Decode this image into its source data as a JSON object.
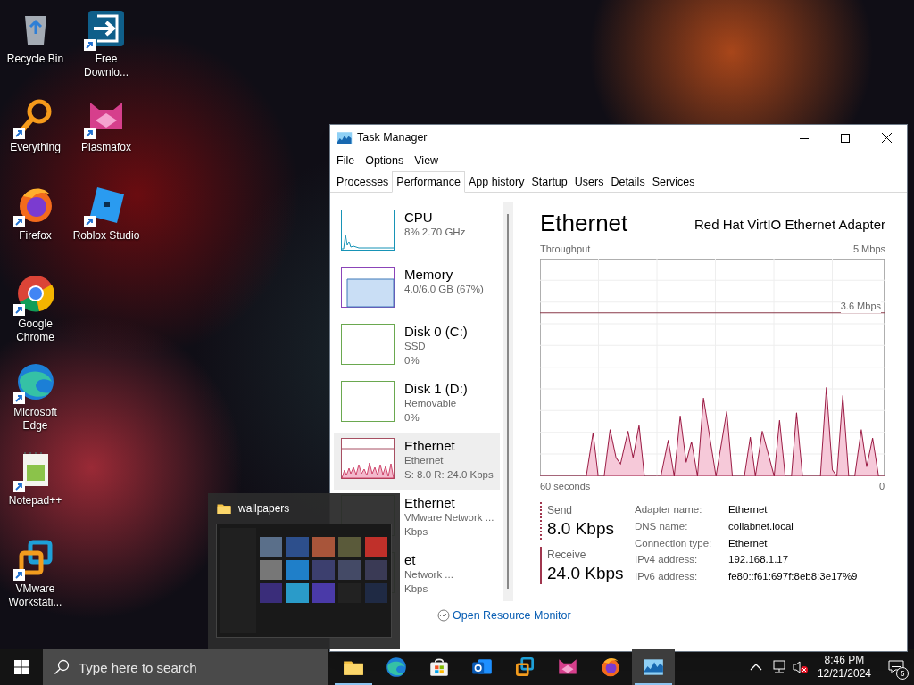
{
  "desktop_icons": [
    {
      "label": "Recycle Bin",
      "kind": "recycle",
      "shortcut": false
    },
    {
      "label": "Everything",
      "kind": "magnifier",
      "shortcut": true
    },
    {
      "label": "Firefox",
      "kind": "fox",
      "shortcut": true
    },
    {
      "label": "Google Chrome",
      "kind": "ring",
      "shortcut": true
    },
    {
      "label": "Microsoft Edge",
      "kind": "wave",
      "shortcut": true
    },
    {
      "label": "Notepad++",
      "kind": "notepad",
      "shortcut": true
    },
    {
      "label": "VMware Workstati...",
      "kind": "squares",
      "shortcut": true
    },
    {
      "label": "Free Downlo...",
      "kind": "download",
      "shortcut": true
    },
    {
      "label": "Plasmafox",
      "kind": "cat",
      "shortcut": true
    },
    {
      "label": "Roblox Studio",
      "kind": "tilted",
      "shortcut": true
    }
  ],
  "window": {
    "title": "Task Manager",
    "menu": [
      "File",
      "Options",
      "View"
    ],
    "tabs": [
      {
        "label": "Processes",
        "selected": false
      },
      {
        "label": "Performance",
        "selected": true
      },
      {
        "label": "App history",
        "selected": false
      },
      {
        "label": "Startup",
        "selected": false
      },
      {
        "label": "Users",
        "selected": false
      },
      {
        "label": "Details",
        "selected": false
      },
      {
        "label": "Services",
        "selected": false
      }
    ],
    "sidebar": [
      {
        "title": "CPU",
        "lines": [
          "8% 2.70 GHz"
        ],
        "kind": "cpu",
        "selected": false
      },
      {
        "title": "Memory",
        "lines": [
          "4.0/6.0 GB (67%)"
        ],
        "kind": "memory",
        "selected": false
      },
      {
        "title": "Disk 0 (C:)",
        "lines": [
          "SSD",
          "0%"
        ],
        "kind": "disk",
        "selected": false
      },
      {
        "title": "Disk 1 (D:)",
        "lines": [
          "Removable",
          "0%"
        ],
        "kind": "disk",
        "selected": false
      },
      {
        "title": "Ethernet",
        "lines": [
          "Ethernet",
          "S: 8.0 R: 24.0 Kbps"
        ],
        "kind": "network",
        "selected": true
      },
      {
        "title": "Ethernet",
        "lines": [
          "VMware Network ...",
          "Kbps"
        ],
        "kind": "disk",
        "selected": false
      },
      {
        "title": "et",
        "lines": [
          "Network ...",
          "Kbps"
        ],
        "kind": "disk",
        "selected": false
      }
    ],
    "panel": {
      "title": "Ethernet",
      "adapter": "Red Hat VirtIO Ethernet Adapter",
      "chart_label": "Throughput",
      "chart_max": "5 Mbps",
      "chart_line_label": "3.6 Mbps",
      "x_start": "60 seconds",
      "x_end": "0",
      "send": {
        "label": "Send",
        "value": "8.0 Kbps"
      },
      "receive": {
        "label": "Receive",
        "value": "24.0 Kbps"
      },
      "details": [
        {
          "key": "Adapter name:",
          "value": "Ethernet"
        },
        {
          "key": "DNS name:",
          "value": "collabnet.local"
        },
        {
          "key": "Connection type:",
          "value": "Ethernet"
        },
        {
          "key": "IPv4 address:",
          "value": "192.168.1.17"
        },
        {
          "key": "IPv6 address:",
          "value": "fe80::f61:697f:8eb8:3e17%9"
        }
      ]
    },
    "footer_link": "Open Resource Monitor"
  },
  "preview": {
    "title": "wallpapers"
  },
  "taskbar": {
    "search_placeholder": "Type here to search",
    "apps": [
      {
        "kind": "folder",
        "running": true,
        "active": false
      },
      {
        "kind": "wave",
        "running": false,
        "active": false
      },
      {
        "kind": "bag",
        "running": false,
        "active": false
      },
      {
        "kind": "mail",
        "running": false,
        "active": false
      },
      {
        "kind": "squares",
        "running": false,
        "active": false
      },
      {
        "kind": "cat",
        "running": false,
        "active": false
      },
      {
        "kind": "fox",
        "running": false,
        "active": false
      },
      {
        "kind": "chart",
        "running": true,
        "active": true
      }
    ],
    "time": "8:46 PM",
    "date": "12/21/2024",
    "notifications": "5"
  }
}
